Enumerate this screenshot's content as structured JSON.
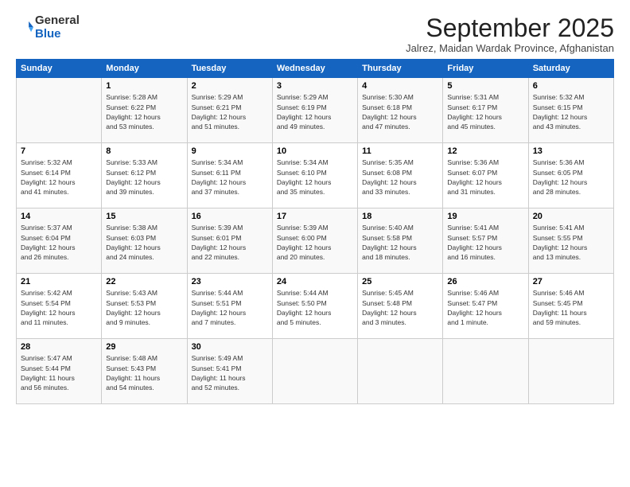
{
  "logo": {
    "general": "General",
    "blue": "Blue"
  },
  "header": {
    "month": "September 2025",
    "location": "Jalrez, Maidan Wardak Province, Afghanistan"
  },
  "days_of_week": [
    "Sunday",
    "Monday",
    "Tuesday",
    "Wednesday",
    "Thursday",
    "Friday",
    "Saturday"
  ],
  "weeks": [
    [
      {
        "day": "",
        "info": ""
      },
      {
        "day": "1",
        "info": "Sunrise: 5:28 AM\nSunset: 6:22 PM\nDaylight: 12 hours\nand 53 minutes."
      },
      {
        "day": "2",
        "info": "Sunrise: 5:29 AM\nSunset: 6:21 PM\nDaylight: 12 hours\nand 51 minutes."
      },
      {
        "day": "3",
        "info": "Sunrise: 5:29 AM\nSunset: 6:19 PM\nDaylight: 12 hours\nand 49 minutes."
      },
      {
        "day": "4",
        "info": "Sunrise: 5:30 AM\nSunset: 6:18 PM\nDaylight: 12 hours\nand 47 minutes."
      },
      {
        "day": "5",
        "info": "Sunrise: 5:31 AM\nSunset: 6:17 PM\nDaylight: 12 hours\nand 45 minutes."
      },
      {
        "day": "6",
        "info": "Sunrise: 5:32 AM\nSunset: 6:15 PM\nDaylight: 12 hours\nand 43 minutes."
      }
    ],
    [
      {
        "day": "7",
        "info": "Sunrise: 5:32 AM\nSunset: 6:14 PM\nDaylight: 12 hours\nand 41 minutes."
      },
      {
        "day": "8",
        "info": "Sunrise: 5:33 AM\nSunset: 6:12 PM\nDaylight: 12 hours\nand 39 minutes."
      },
      {
        "day": "9",
        "info": "Sunrise: 5:34 AM\nSunset: 6:11 PM\nDaylight: 12 hours\nand 37 minutes."
      },
      {
        "day": "10",
        "info": "Sunrise: 5:34 AM\nSunset: 6:10 PM\nDaylight: 12 hours\nand 35 minutes."
      },
      {
        "day": "11",
        "info": "Sunrise: 5:35 AM\nSunset: 6:08 PM\nDaylight: 12 hours\nand 33 minutes."
      },
      {
        "day": "12",
        "info": "Sunrise: 5:36 AM\nSunset: 6:07 PM\nDaylight: 12 hours\nand 31 minutes."
      },
      {
        "day": "13",
        "info": "Sunrise: 5:36 AM\nSunset: 6:05 PM\nDaylight: 12 hours\nand 28 minutes."
      }
    ],
    [
      {
        "day": "14",
        "info": "Sunrise: 5:37 AM\nSunset: 6:04 PM\nDaylight: 12 hours\nand 26 minutes."
      },
      {
        "day": "15",
        "info": "Sunrise: 5:38 AM\nSunset: 6:03 PM\nDaylight: 12 hours\nand 24 minutes."
      },
      {
        "day": "16",
        "info": "Sunrise: 5:39 AM\nSunset: 6:01 PM\nDaylight: 12 hours\nand 22 minutes."
      },
      {
        "day": "17",
        "info": "Sunrise: 5:39 AM\nSunset: 6:00 PM\nDaylight: 12 hours\nand 20 minutes."
      },
      {
        "day": "18",
        "info": "Sunrise: 5:40 AM\nSunset: 5:58 PM\nDaylight: 12 hours\nand 18 minutes."
      },
      {
        "day": "19",
        "info": "Sunrise: 5:41 AM\nSunset: 5:57 PM\nDaylight: 12 hours\nand 16 minutes."
      },
      {
        "day": "20",
        "info": "Sunrise: 5:41 AM\nSunset: 5:55 PM\nDaylight: 12 hours\nand 13 minutes."
      }
    ],
    [
      {
        "day": "21",
        "info": "Sunrise: 5:42 AM\nSunset: 5:54 PM\nDaylight: 12 hours\nand 11 minutes."
      },
      {
        "day": "22",
        "info": "Sunrise: 5:43 AM\nSunset: 5:53 PM\nDaylight: 12 hours\nand 9 minutes."
      },
      {
        "day": "23",
        "info": "Sunrise: 5:44 AM\nSunset: 5:51 PM\nDaylight: 12 hours\nand 7 minutes."
      },
      {
        "day": "24",
        "info": "Sunrise: 5:44 AM\nSunset: 5:50 PM\nDaylight: 12 hours\nand 5 minutes."
      },
      {
        "day": "25",
        "info": "Sunrise: 5:45 AM\nSunset: 5:48 PM\nDaylight: 12 hours\nand 3 minutes."
      },
      {
        "day": "26",
        "info": "Sunrise: 5:46 AM\nSunset: 5:47 PM\nDaylight: 12 hours\nand 1 minute."
      },
      {
        "day": "27",
        "info": "Sunrise: 5:46 AM\nSunset: 5:45 PM\nDaylight: 11 hours\nand 59 minutes."
      }
    ],
    [
      {
        "day": "28",
        "info": "Sunrise: 5:47 AM\nSunset: 5:44 PM\nDaylight: 11 hours\nand 56 minutes."
      },
      {
        "day": "29",
        "info": "Sunrise: 5:48 AM\nSunset: 5:43 PM\nDaylight: 11 hours\nand 54 minutes."
      },
      {
        "day": "30",
        "info": "Sunrise: 5:49 AM\nSunset: 5:41 PM\nDaylight: 11 hours\nand 52 minutes."
      },
      {
        "day": "",
        "info": ""
      },
      {
        "day": "",
        "info": ""
      },
      {
        "day": "",
        "info": ""
      },
      {
        "day": "",
        "info": ""
      }
    ]
  ]
}
